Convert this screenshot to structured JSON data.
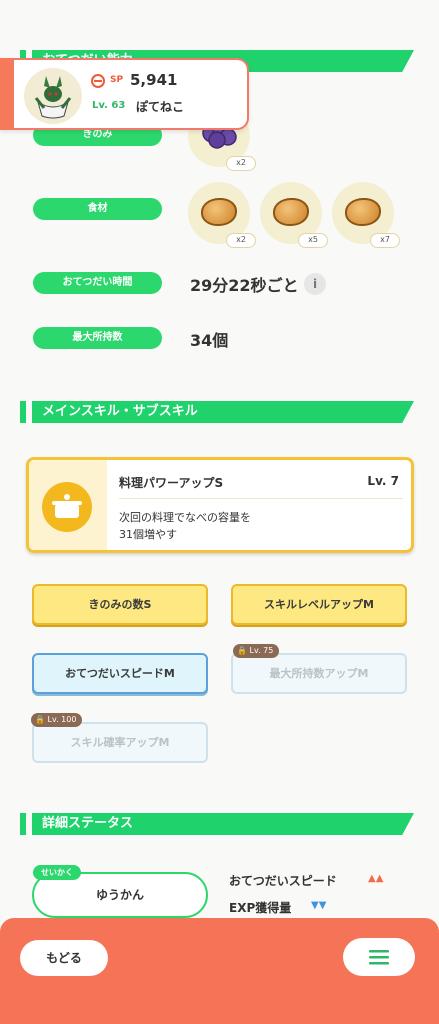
{
  "profile": {
    "sp_label": "SP",
    "sp_value": "5,941",
    "level": "Lv. 63",
    "nickname": "ぽてねこ"
  },
  "help_section": {
    "title": "おてつだい能力",
    "berries_label": "きのみ",
    "berry_qty": "x2",
    "ingredients_label": "食材",
    "ingredients": [
      {
        "qty": "x2"
      },
      {
        "qty": "x5"
      },
      {
        "qty": "x7"
      }
    ],
    "help_time_label": "おてつだい時間",
    "help_time_value": "29分22秒ごと",
    "max_carry_label": "最大所持数",
    "max_carry_value": "34個"
  },
  "skill_section": {
    "title": "メインスキル・サブスキル",
    "main_skill": {
      "name": "料理パワーアップS",
      "level": "Lv. 7",
      "description_line1": "次回の料理でなべの容量を",
      "description_line2": "31個増やす"
    },
    "sub_skills": [
      {
        "label": "きのみの数S"
      },
      {
        "label": "スキルレベルアップM"
      },
      {
        "label": "おてつだいスピードM"
      },
      {
        "label": "最大所持数アップM",
        "lock_level": "Lv. 75"
      },
      {
        "label": "スキル確率アップM",
        "lock_level": "Lv. 100"
      }
    ]
  },
  "detail_section": {
    "title": "詳細ステータス",
    "nature_tag": "せいかく",
    "nature_value": "ゆうかん",
    "up_stat": "おてつだいスピード",
    "up_marks": "▲▲",
    "down_stat": "EXP獲得量",
    "down_marks": "▼▼"
  },
  "bottom": {
    "back_label": "もどる"
  },
  "colors": {
    "accent_green": "#1fd26c",
    "bottom_bar": "#f57457",
    "gold": "#f5c23a",
    "up_red": "#f26b4f",
    "down_blue": "#3e93e0"
  }
}
